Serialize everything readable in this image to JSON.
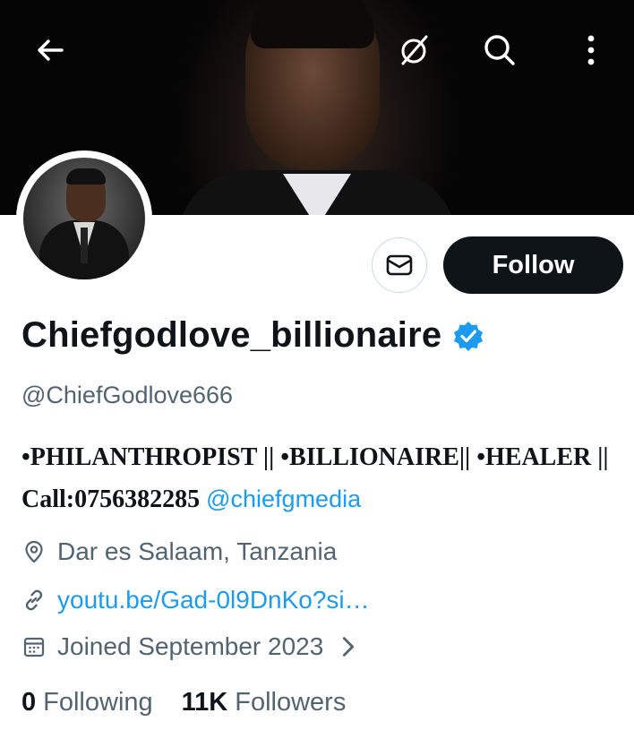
{
  "header": {
    "back_icon": "arrow-left-icon",
    "grok_icon": "grok-icon",
    "search_icon": "search-icon",
    "more_icon": "more-vertical-icon"
  },
  "profile": {
    "display_name": "Chiefgodlove_billionaire",
    "verified": true,
    "handle": "@ChiefGodlove666",
    "bio_text": "•PHILANTHROPIST || •BILLIONAIRE|| •HEALER || Call:0756382285",
    "bio_mention": "@chiefgmedia",
    "location": "Dar es Salaam, Tanzania",
    "website": "youtu.be/Gad-0l9DnKo?si…",
    "joined": "Joined September 2023",
    "following_count": "0",
    "following_label": "Following",
    "followers_count": "11K",
    "followers_label": "Followers"
  },
  "actions": {
    "follow_label": "Follow",
    "message_icon": "mail-icon"
  },
  "colors": {
    "accent": "#1d9bf0",
    "text": "#0f1419",
    "muted": "#536471",
    "button_bg": "#0f1419"
  }
}
